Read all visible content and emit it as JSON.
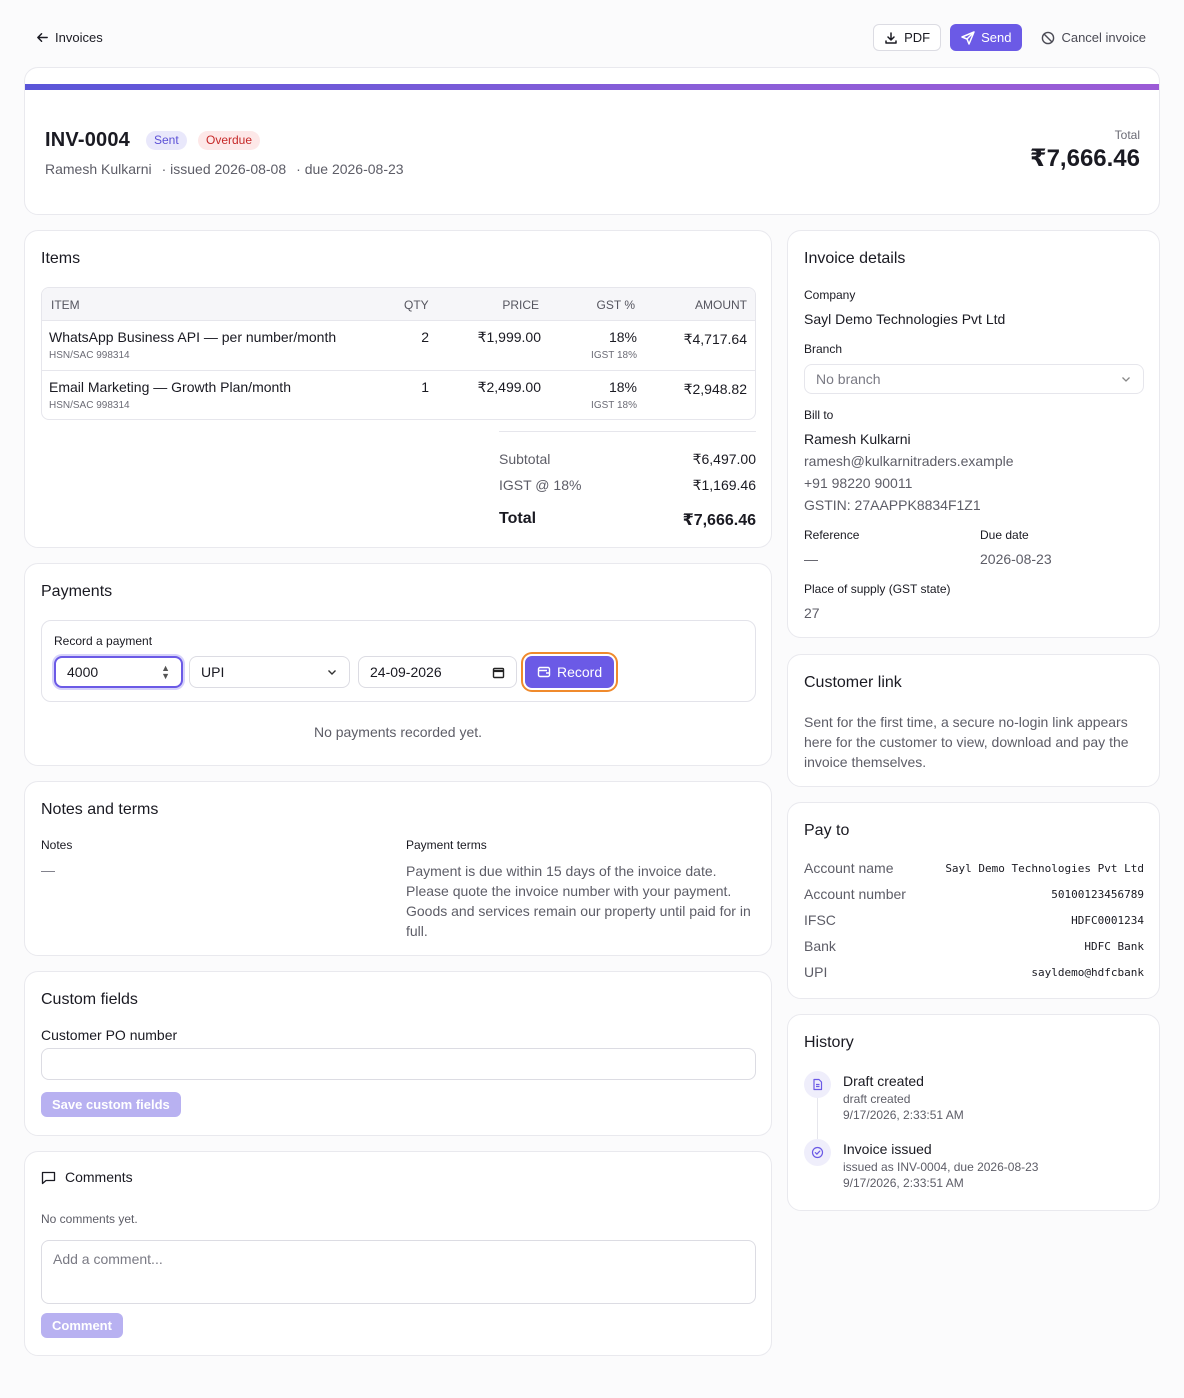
{
  "topbar": {
    "back_label": "Invoices",
    "pdf_label": "PDF",
    "send_label": "Send",
    "cancel_label": "Cancel invoice"
  },
  "invoice": {
    "number": "INV-0004",
    "badges": {
      "sent": "Sent",
      "overdue": "Overdue"
    },
    "customer": "Ramesh Kulkarni",
    "issued": "· issued 2026-08-08",
    "due": "· due 2026-08-23",
    "total_label": "Total",
    "total": "₹7,666.46"
  },
  "items": {
    "title": "Items",
    "headers": {
      "item": "ITEM",
      "qty": "QTY",
      "price": "PRICE",
      "gst": "GST %",
      "amount": "AMOUNT"
    },
    "rows": [
      {
        "name": "WhatsApp Business API — per number/month",
        "hsn": "HSN/SAC 998314",
        "qty": "2",
        "price": "₹1,999.00",
        "gst": "18%",
        "gst_sub": "IGST 18%",
        "amount": "₹4,717.64"
      },
      {
        "name": "Email Marketing — Growth Plan/month",
        "hsn": "HSN/SAC 998314",
        "qty": "1",
        "price": "₹2,499.00",
        "gst": "18%",
        "gst_sub": "IGST 18%",
        "amount": "₹2,948.82"
      }
    ],
    "summary": {
      "subtotal_label": "Subtotal",
      "subtotal": "₹6,497.00",
      "tax_label": "IGST @ 18%",
      "tax": "₹1,169.46",
      "total_label": "Total",
      "total": "₹7,666.46"
    }
  },
  "payments": {
    "title": "Payments",
    "record_label": "Record a payment",
    "amount_value": "4000",
    "method_value": "UPI",
    "date_value": "24-09-2026",
    "record_button": "Record",
    "empty": "No payments recorded yet."
  },
  "notes": {
    "title": "Notes and terms",
    "notes_label": "Notes",
    "notes_value": "—",
    "terms_label": "Payment terms",
    "terms_value": "Payment is due within 15 days of the invoice date. Please quote the invoice number with your payment. Goods and services remain our property until paid for in full."
  },
  "custom_fields": {
    "title": "Custom fields",
    "po_label": "Customer PO number",
    "po_value": "",
    "save_button": "Save custom fields"
  },
  "comments": {
    "title": "Comments",
    "empty": "No comments yet.",
    "placeholder": "Add a comment...",
    "button": "Comment"
  },
  "details": {
    "title": "Invoice details",
    "company_label": "Company",
    "company": "Sayl Demo Technologies Pvt Ltd",
    "branch_label": "Branch",
    "branch_value": "No branch",
    "bill_to_label": "Bill to",
    "bill_name": "Ramesh Kulkarni",
    "bill_email": "ramesh@kulkarnitraders.example",
    "bill_phone": "+91 98220 90011",
    "bill_gstin": "GSTIN: 27AAPPK8834F1Z1",
    "reference_label": "Reference",
    "reference": "—",
    "due_label": "Due date",
    "due": "2026-08-23",
    "supply_label": "Place of supply (GST state)",
    "supply": "27"
  },
  "customer_link": {
    "title": "Customer link",
    "text": "Sent for the first time, a secure no-login link appears here for the customer to view, download and pay the invoice themselves."
  },
  "pay_to": {
    "title": "Pay to",
    "rows": [
      {
        "label": "Account name",
        "value": "Sayl Demo Technologies Pvt Ltd"
      },
      {
        "label": "Account number",
        "value": "50100123456789"
      },
      {
        "label": "IFSC",
        "value": "HDFC0001234"
      },
      {
        "label": "Bank",
        "value": "HDFC Bank"
      },
      {
        "label": "UPI",
        "value": "sayldemo@hdfcbank"
      }
    ]
  },
  "history": {
    "title": "History",
    "events": [
      {
        "title": "Draft created",
        "sub": "draft created",
        "time": "9/17/2026, 2:33:51 AM",
        "icon": "file-icon"
      },
      {
        "title": "Invoice issued",
        "sub": "issued as INV-0004, due 2026-08-23",
        "time": "9/17/2026, 2:33:51 AM",
        "icon": "check-circle-icon"
      }
    ]
  },
  "colors": {
    "accent": "#6b5ae6",
    "focus_ring": "#f08a2c",
    "overdue": "#c62828"
  }
}
